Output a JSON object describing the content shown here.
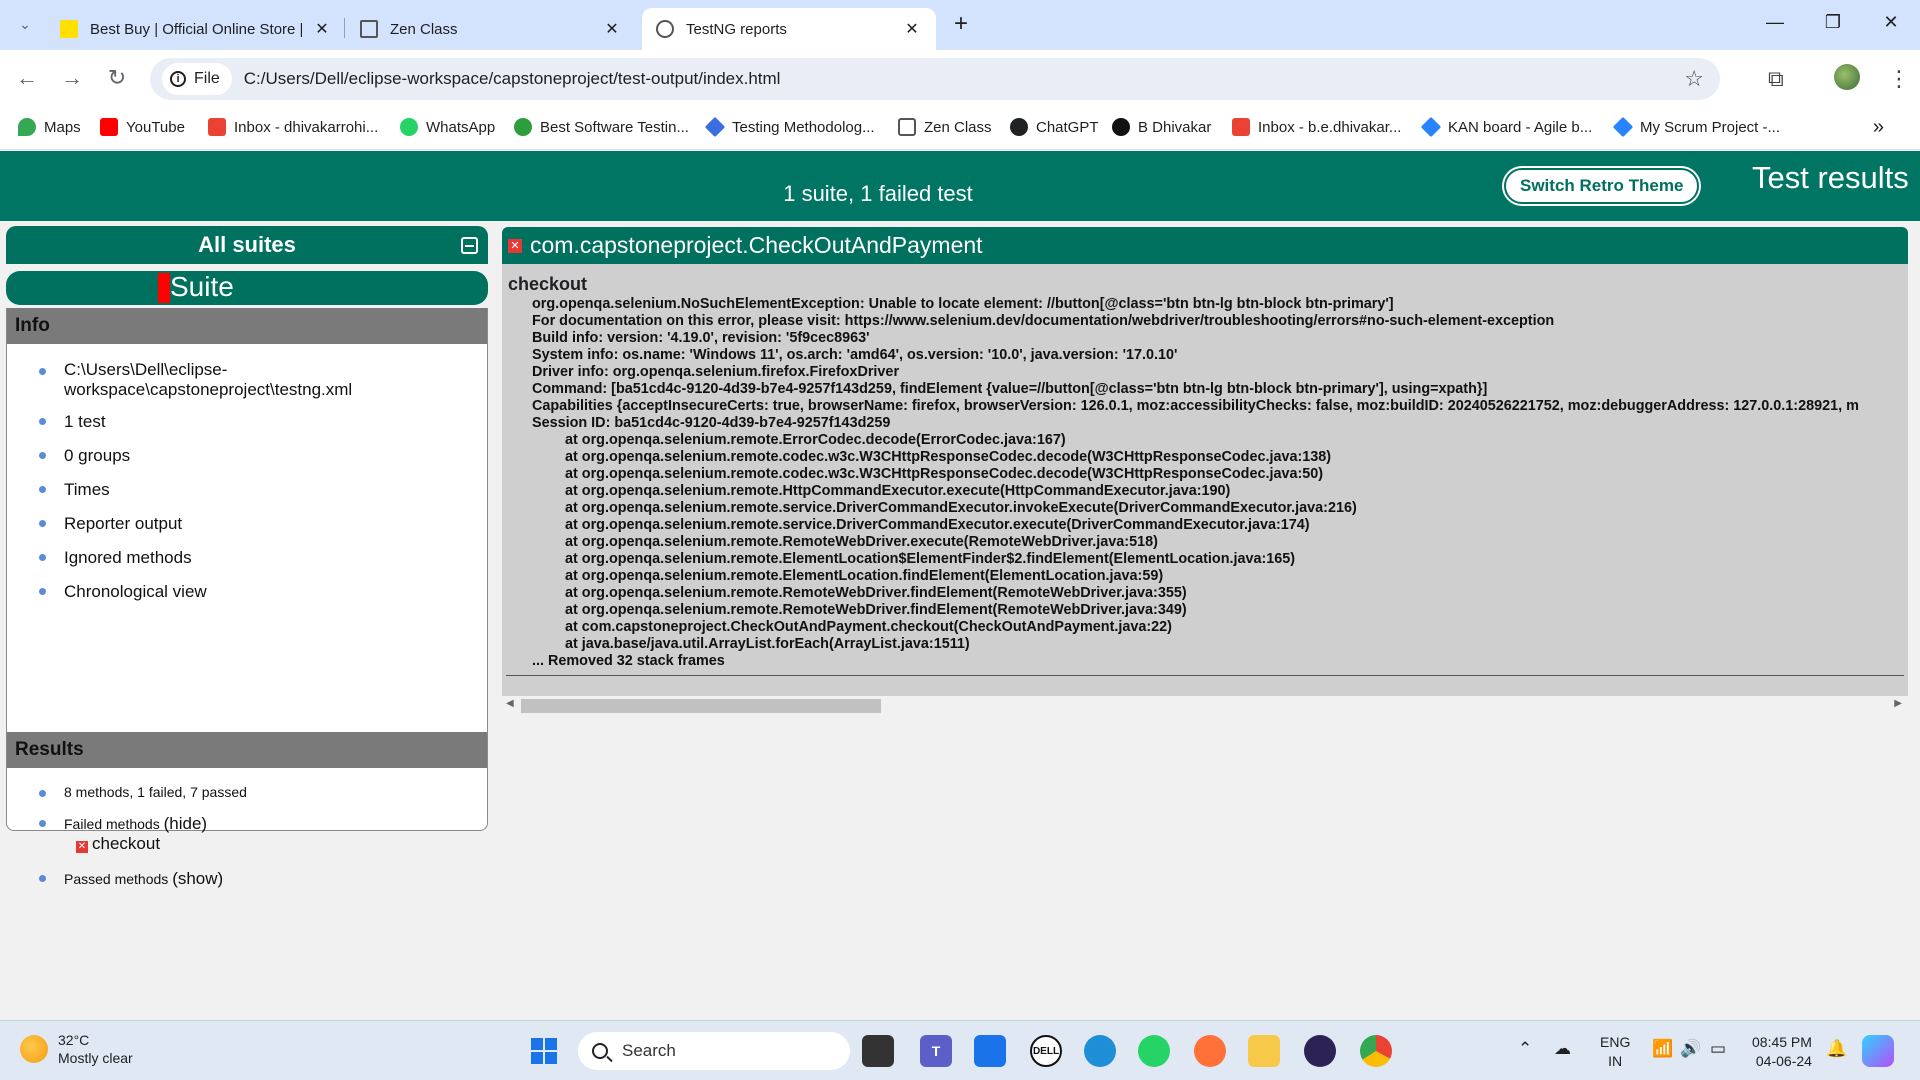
{
  "browser": {
    "tabs": [
      {
        "title": "Best Buy | Official Online Store |",
        "close": "✕"
      },
      {
        "title": "Zen Class",
        "close": "✕"
      },
      {
        "title": "TestNG reports",
        "close": "✕"
      }
    ],
    "new_tab": "+",
    "window_controls": {
      "minimize": "—",
      "restore": "❐",
      "close": "✕"
    },
    "address": {
      "scheme_label": "File",
      "url": "C:/Users/Dell/eclipse-workspace/capstoneproject/test-output/index.html"
    },
    "bookmarks": [
      {
        "label": "Maps",
        "icon": "maps-pin-icon",
        "color": "#34a853"
      },
      {
        "label": "YouTube",
        "icon": "youtube-icon",
        "color": "#ff0000"
      },
      {
        "label": "Inbox - dhivakarrohi...",
        "icon": "gmail-icon",
        "color": "#ea4335"
      },
      {
        "label": "WhatsApp",
        "icon": "whatsapp-icon",
        "color": "#25d366"
      },
      {
        "label": "Best Software Testin...",
        "icon": "site-icon",
        "color": "#2e9d3b"
      },
      {
        "label": "Testing Methodolog...",
        "icon": "diamond-icon",
        "color": "#3b6fe0"
      },
      {
        "label": "Zen Class",
        "icon": "zen-icon",
        "color": "#555555"
      },
      {
        "label": "ChatGPT",
        "icon": "chatgpt-icon",
        "color": "#202123"
      },
      {
        "label": "B Dhivakar",
        "icon": "github-icon",
        "color": "#111111"
      },
      {
        "label": "Inbox - b.e.dhivakar...",
        "icon": "gmail-icon",
        "color": "#ea4335"
      },
      {
        "label": "KAN board - Agile b...",
        "icon": "jira-icon",
        "color": "#2684ff"
      },
      {
        "label": "My Scrum Project -...",
        "icon": "jira-icon",
        "color": "#2684ff"
      }
    ]
  },
  "report": {
    "summary": "1 suite, 1 failed test",
    "retro_button": "Switch Retro Theme",
    "title": "Test results",
    "sidebar": {
      "all_suites": "All suites",
      "suite_name": "Suite",
      "info_heading": "Info",
      "info_items": [
        "C:\\Users\\Dell\\eclipse-workspace\\capstoneproject\\testng.xml",
        "1 test",
        "0 groups",
        "Times",
        "Reporter output",
        "Ignored methods",
        "Chronological view"
      ],
      "results_heading": "Results",
      "results_summary": "8 methods, 1 failed, 7 passed",
      "failed_label": "Failed methods",
      "failed_toggle": "(hide)",
      "failed_method": "checkout",
      "passed_label": "Passed methods",
      "passed_toggle": "(show)"
    },
    "main": {
      "class_name": "com.capstoneproject.CheckOutAndPayment",
      "method": "checkout",
      "stack_lines": [
        "org.openqa.selenium.NoSuchElementException: Unable to locate element: //button[@class='btn btn-lg btn-block btn-primary']",
        "For documentation on this error, please visit: https://www.selenium.dev/documentation/webdriver/troubleshooting/errors#no-such-element-exception",
        "Build info: version: '4.19.0', revision: '5f9cec8963'",
        "System info: os.name: 'Windows 11', os.arch: 'amd64', os.version: '10.0', java.version: '17.0.10'",
        "Driver info: org.openqa.selenium.firefox.FirefoxDriver",
        "Command: [ba51cd4c-9120-4d39-b7e4-9257f143d259, findElement {value=//button[@class='btn btn-lg btn-block btn-primary'], using=xpath}]",
        "Capabilities {acceptInsecureCerts: true, browserName: firefox, browserVersion: 126.0.1, moz:accessibilityChecks: false, moz:buildID: 20240526221752, moz:debuggerAddress: 127.0.0.1:28921, m",
        "Session ID: ba51cd4c-9120-4d39-b7e4-9257f143d259"
      ],
      "stack_frames": [
        "at org.openqa.selenium.remote.ErrorCodec.decode(ErrorCodec.java:167)",
        "at org.openqa.selenium.remote.codec.w3c.W3CHttpResponseCodec.decode(W3CHttpResponseCodec.java:138)",
        "at org.openqa.selenium.remote.codec.w3c.W3CHttpResponseCodec.decode(W3CHttpResponseCodec.java:50)",
        "at org.openqa.selenium.remote.HttpCommandExecutor.execute(HttpCommandExecutor.java:190)",
        "at org.openqa.selenium.remote.service.DriverCommandExecutor.invokeExecute(DriverCommandExecutor.java:216)",
        "at org.openqa.selenium.remote.service.DriverCommandExecutor.execute(DriverCommandExecutor.java:174)",
        "at org.openqa.selenium.remote.RemoteWebDriver.execute(RemoteWebDriver.java:518)",
        "at org.openqa.selenium.remote.ElementLocation$ElementFinder$2.findElement(ElementLocation.java:165)",
        "at org.openqa.selenium.remote.ElementLocation.findElement(ElementLocation.java:59)",
        "at org.openqa.selenium.remote.RemoteWebDriver.findElement(RemoteWebDriver.java:355)",
        "at org.openqa.selenium.remote.RemoteWebDriver.findElement(RemoteWebDriver.java:349)",
        "at com.capstoneproject.CheckOutAndPayment.checkout(CheckOutAndPayment.java:22)",
        "at java.base/java.util.ArrayList.forEach(ArrayList.java:1511)"
      ],
      "removed": "... Removed 32 stack frames"
    },
    "colors": {
      "header": "#007564",
      "panel": "#00705f",
      "fail": "#e53935"
    }
  },
  "taskbar": {
    "weather": {
      "temp": "32°C",
      "desc": "Mostly clear"
    },
    "search_placeholder": "Search",
    "language": {
      "line1": "ENG",
      "line2": "IN"
    },
    "clock": {
      "time": "08:45 PM",
      "date": "04-06-24"
    }
  }
}
